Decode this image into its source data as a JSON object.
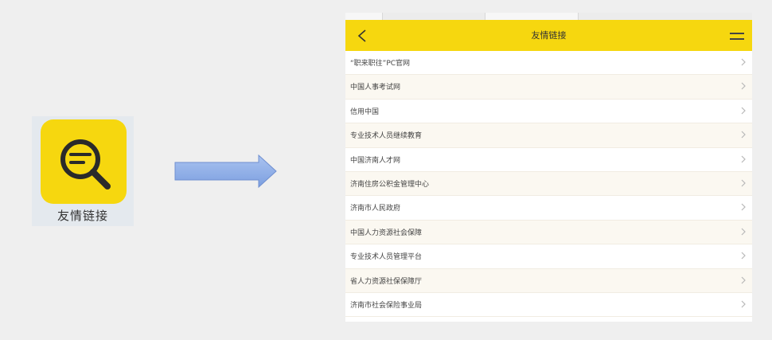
{
  "app_tile": {
    "icon": "magnifier-document-icon",
    "label": "友情链接",
    "accent": "#f6d70f"
  },
  "transition": {
    "icon": "right-arrow-icon",
    "color": "#8fb0e8"
  },
  "screen": {
    "header": {
      "back_icon": "chevron-left-icon",
      "title": "友情链接",
      "menu_icon": "hamburger-menu-icon",
      "background": "#f6d70f"
    },
    "links": [
      {
        "label": "“职来职往”PC官网"
      },
      {
        "label": "中国人事考试网"
      },
      {
        "label": "信用中国"
      },
      {
        "label": "专业技术人员继续教育"
      },
      {
        "label": "中国济南人才网"
      },
      {
        "label": "济南住房公积金管理中心"
      },
      {
        "label": "济南市人民政府"
      },
      {
        "label": "中国人力资源社会保障"
      },
      {
        "label": "专业技术人员管理平台"
      },
      {
        "label": "省人力资源社保保障厅"
      },
      {
        "label": "济南市社会保险事业局"
      }
    ],
    "item_chevron_icon": "chevron-right-icon"
  }
}
